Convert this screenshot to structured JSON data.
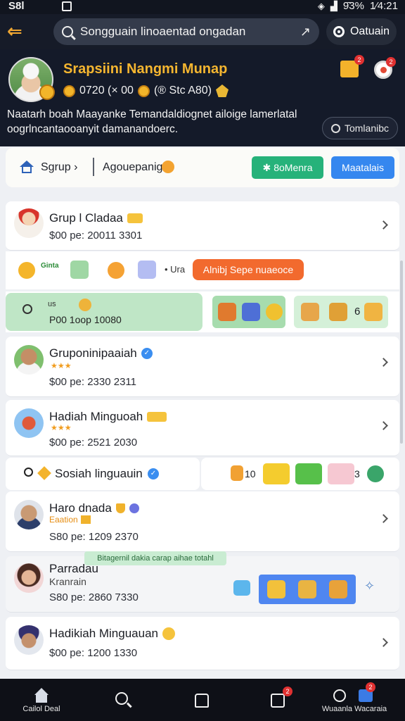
{
  "status_bar": {
    "carrier": "S8l",
    "battery": "9̄3%",
    "time": "1⁄4:21"
  },
  "header": {
    "search_text": "Songguain linoaentad ongadan",
    "control_label": "Oatuain"
  },
  "profile": {
    "name": "Srapsiini Nangmi Munap",
    "stats_a": "0720 (× 00",
    "stats_b": "(® Stc A80)",
    "description": "Naatarh boah Maayanke Temandaldiognet ailoige lamerlatal oogrlncantaooanyit damanandoerc.",
    "translate_label": "Tomlanibc",
    "notification_badge": "2",
    "gift_badge": "2"
  },
  "breadcrumb": {
    "item_1": "Sgrup ›",
    "item_2": "Agouepanig",
    "green_button": "8oMenra",
    "blue_button": "Maatalais"
  },
  "groups": [
    {
      "title": "Grup l Cladaa",
      "sub": "$00 pe: 20011 3301"
    },
    {
      "title": "Gruponinipaaiah",
      "sub": "$00 pe: 2330 2311"
    },
    {
      "title": "Hadiah Minguoah",
      "sub": "$00 pe: 2521 2030"
    },
    {
      "title": "Haro dnada",
      "sub_tag": "Eaation",
      "sub": "S80 pe: 1209 2370"
    },
    {
      "title": "Parradau",
      "sub_tag": "Kranrain",
      "sub": "S80 pe: 2860 7330"
    },
    {
      "title": "Hadikiah Minguauan",
      "sub": "$00 pe: 1200 1330"
    }
  ],
  "items_row_1": {
    "label": "Ginta",
    "more": "• Ura",
    "promo": "Alnibj Sepe nuaeoce"
  },
  "items_row_2": {
    "left_text": "P00 1oop 10080",
    "left_top": "us",
    "count": "6"
  },
  "social_row": {
    "label": "Sosiah linguauin",
    "count_a": "10",
    "count_b": "3"
  },
  "tooltip": "Bitagernil dakia carap aihae totahl",
  "bottom_nav": {
    "home_label": "Cailol Deal",
    "right_label": "Wuaanla Wacaraia",
    "inbox_badge": "2",
    "wallet_badge": "2"
  },
  "colors": {
    "accent_gold": "#f5b630",
    "accent_green": "#26b27a",
    "accent_blue": "#3587ef",
    "promo_orange": "#f26a2e",
    "header_bg": "#141a29"
  }
}
